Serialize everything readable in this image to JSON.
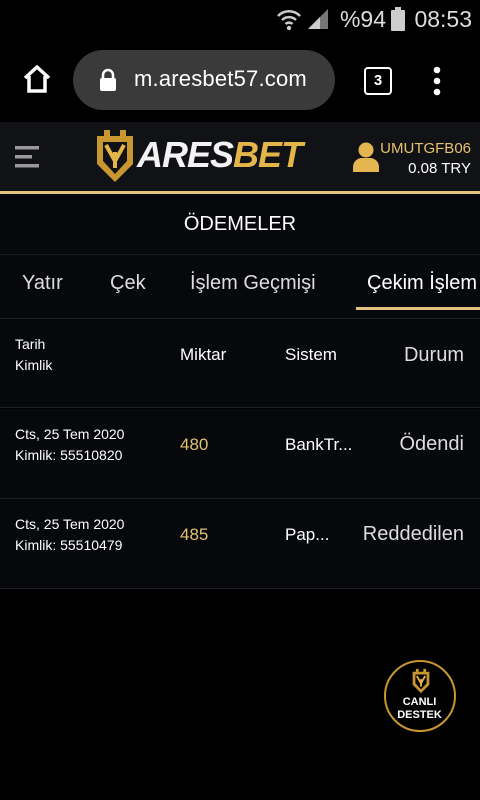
{
  "status_bar": {
    "battery": "%94",
    "time": "08:53"
  },
  "browser": {
    "url": "m.aresbet57.com",
    "tab_count": "3"
  },
  "header": {
    "brand_part1": "ARES",
    "brand_part2": "BET",
    "username": "UMUTGFB06",
    "balance": "0.08 TRY",
    "accent": "#e2c27d"
  },
  "page_title": "ÖDEMELER",
  "tabs": [
    {
      "label": "Yatır"
    },
    {
      "label": "Çek"
    },
    {
      "label": "İşlem Geçmişi"
    },
    {
      "label": "Çekim İşlem",
      "active": true
    }
  ],
  "table": {
    "headers": {
      "date": "Tarih",
      "id": "Kimlik",
      "amount": "Miktar",
      "system": "Sistem",
      "status": "Durum"
    },
    "rows": [
      {
        "date": "Cts, 25 Tem 2020",
        "id": "Kimlik: 55510820",
        "amount": "480",
        "system": "BankTr...",
        "status": "Ödendi"
      },
      {
        "date": "Cts, 25 Tem 2020",
        "id": "Kimlik: 55510479",
        "amount": "485",
        "system": "Pap...",
        "status": "Reddedilen"
      }
    ]
  },
  "live_support": {
    "line1": "CANLI",
    "line2": "DESTEK"
  }
}
